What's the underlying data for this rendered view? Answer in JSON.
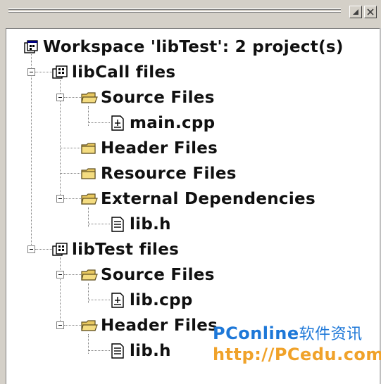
{
  "workspace_label": "Workspace 'libTest': 2 project(s)",
  "projects": [
    {
      "label": "libCall files",
      "folders": [
        {
          "label": "Source Files",
          "files": [
            "main.cpp"
          ]
        },
        {
          "label": "Header Files",
          "files": []
        },
        {
          "label": "Resource Files",
          "files": []
        },
        {
          "label": "External Dependencies",
          "files": [
            "lib.h"
          ]
        }
      ]
    },
    {
      "label": "libTest files",
      "folders": [
        {
          "label": "Source Files",
          "files": [
            "lib.cpp"
          ]
        },
        {
          "label": "Header Files",
          "files": [
            "lib.h"
          ]
        }
      ]
    }
  ],
  "watermark": {
    "brand": "PConline",
    "brand_cn": "软件资讯",
    "url": "http://PCedu.com"
  },
  "colors": {
    "folder": "#e8c860",
    "watermark_blue": "#1e78d8",
    "watermark_orange": "#f0a22a"
  }
}
